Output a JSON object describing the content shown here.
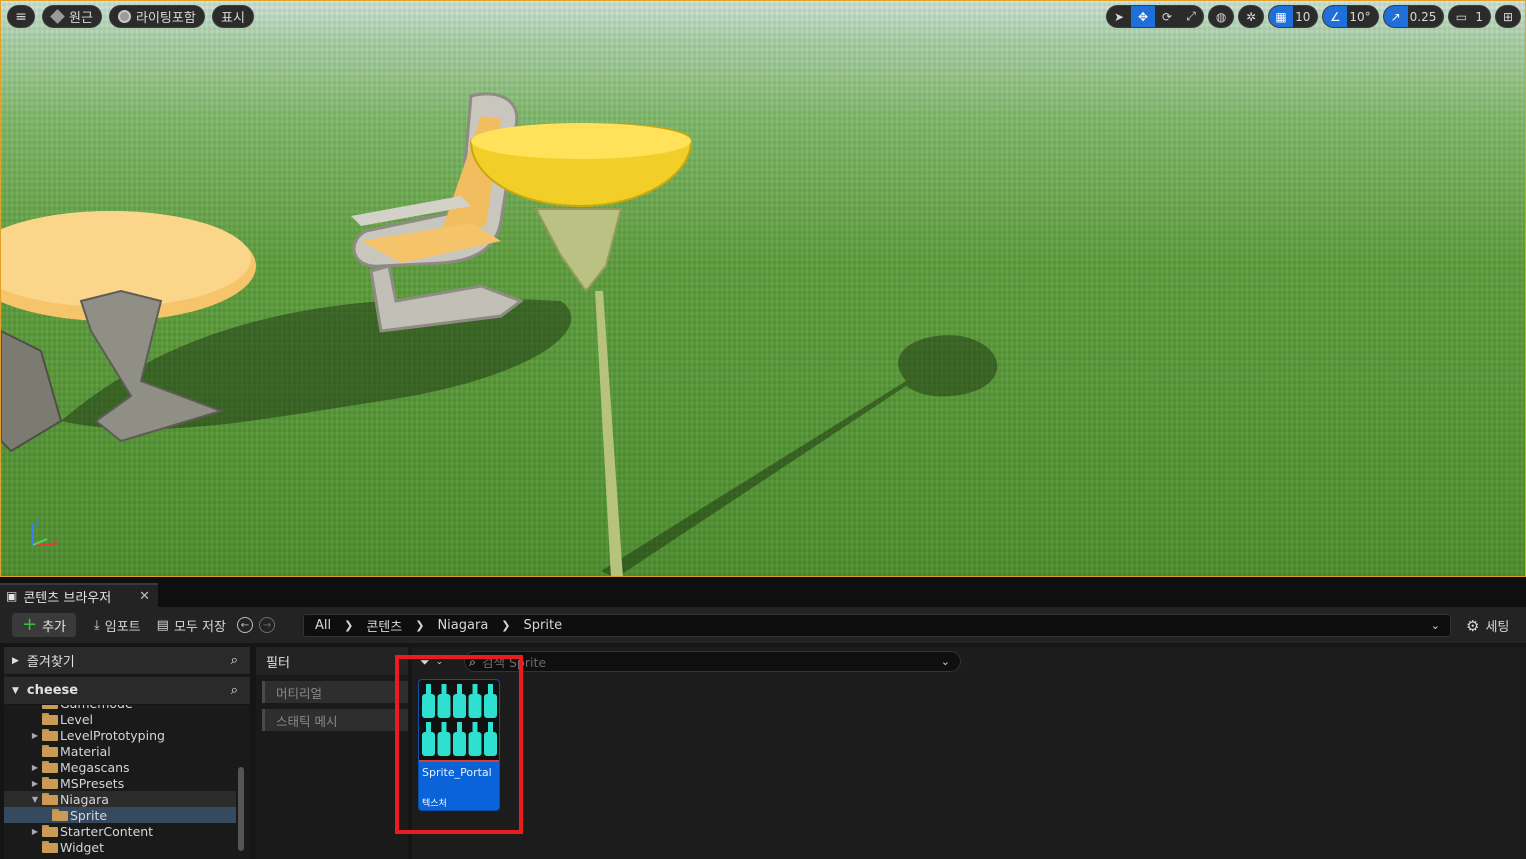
{
  "viewport": {
    "menu_icon": "hamburger-icon",
    "perspective_label": "원근",
    "lighting_label": "라이팅포함",
    "show_label": "표시",
    "snap": {
      "grid_value": "10",
      "rotation_value": "10°",
      "scale_value": "0.25",
      "camera_speed": "1"
    }
  },
  "content_browser": {
    "tab_title": "콘텐츠 브라우저",
    "toolbar": {
      "add_label": "추가",
      "import_label": "임포트",
      "save_all_label": "모두 저장",
      "settings_label": "세팅"
    },
    "breadcrumb": [
      "All",
      "콘텐츠",
      "Niagara",
      "Sprite"
    ],
    "favorites_label": "즐겨찾기",
    "project_label": "cheese",
    "folders": [
      {
        "label": "Gamemode",
        "indent": 1,
        "expander": ""
      },
      {
        "label": "Level",
        "indent": 1,
        "expander": ""
      },
      {
        "label": "LevelPrototyping",
        "indent": 1,
        "expander": "▶"
      },
      {
        "label": "Material",
        "indent": 1,
        "expander": ""
      },
      {
        "label": "Megascans",
        "indent": 1,
        "expander": "▶"
      },
      {
        "label": "MSPresets",
        "indent": 1,
        "expander": "▶"
      },
      {
        "label": "Niagara",
        "indent": 1,
        "expander": "▼"
      },
      {
        "label": "Sprite",
        "indent": 2,
        "expander": ""
      },
      {
        "label": "StarterContent",
        "indent": 1,
        "expander": "▶"
      },
      {
        "label": "Widget",
        "indent": 1,
        "expander": ""
      }
    ],
    "filters_header": "필터",
    "filters": [
      "머티리얼",
      "스태틱 메시"
    ],
    "search_placeholder": "검색 Sprite",
    "assets": [
      {
        "name": "Sprite_Portal",
        "type": "텍스처",
        "thumb_color": "#2de0d0",
        "tile_color": "#0a63d8"
      }
    ]
  }
}
